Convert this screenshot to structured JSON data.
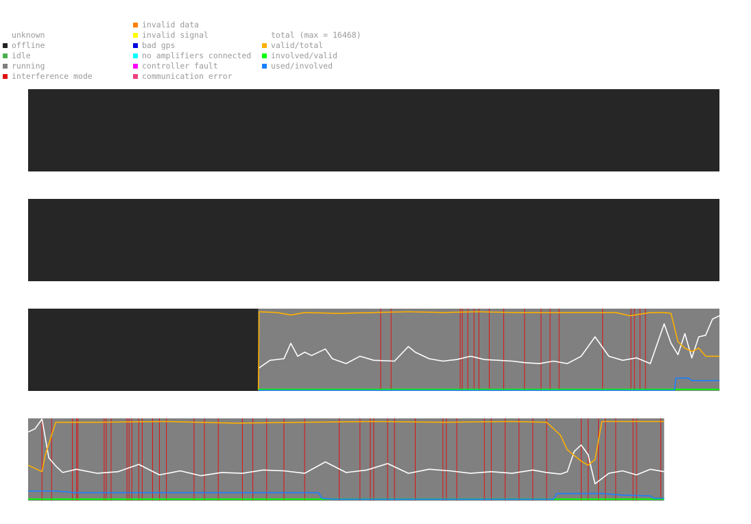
{
  "legend": {
    "columns": [
      {
        "items": [
          {
            "label": "unknown",
            "color": null
          },
          {
            "label": "offline",
            "color": "#222222"
          },
          {
            "label": "idle",
            "color": "#4caf50"
          },
          {
            "label": "running",
            "color": "#808080"
          },
          {
            "label": "interference mode",
            "color": "#e01010"
          }
        ]
      },
      {
        "items": [
          {
            "label": "invalid data",
            "color": "#ff7f00"
          },
          {
            "label": "invalid signal",
            "color": "#ffff00"
          },
          {
            "label": "bad gps",
            "color": "#0000e0"
          },
          {
            "label": "no amplifiers connected",
            "color": "#00ffff"
          },
          {
            "label": "controller fault",
            "color": "#ff00ff"
          },
          {
            "label": "communication error",
            "color": "#f04080"
          }
        ]
      },
      {
        "items": [
          {
            "label": "total (max = 16468)",
            "color": null
          },
          {
            "label": "valid/total",
            "color": "#ffb000"
          },
          {
            "label": "involved/valid",
            "color": "#00ff00"
          },
          {
            "label": "used/involved",
            "color": "#1a7fff"
          }
        ]
      }
    ]
  },
  "colors": {
    "offline_bg": "#262626",
    "running_bg": "#808080",
    "interference": "#e01010",
    "total_line": "#ffffff",
    "valid_total": "#ffb000",
    "involved_valid": "#00ff00",
    "used_involved": "#1a7fff"
  },
  "chart_data": [
    {
      "type": "line",
      "title": "",
      "status": "offline",
      "series": []
    },
    {
      "type": "line",
      "title": "",
      "status": "offline",
      "series": []
    },
    {
      "type": "line",
      "title": "",
      "status_segments": [
        {
          "status": "offline",
          "from": 0.0,
          "to": 0.333
        },
        {
          "status": "running",
          "from": 0.333,
          "to": 1.0
        }
      ],
      "interference_marks": [
        0.51,
        0.525,
        0.625,
        0.628,
        0.636,
        0.645,
        0.652,
        0.667,
        0.688,
        0.718,
        0.742,
        0.755,
        0.768,
        0.831,
        0.872,
        0.877,
        0.885,
        0.893
      ],
      "series": [
        {
          "name": "total (max = 16468)",
          "x": [
            0.333,
            0.35,
            0.37,
            0.38,
            0.39,
            0.4,
            0.41,
            0.43,
            0.44,
            0.46,
            0.48,
            0.5,
            0.53,
            0.55,
            0.56,
            0.58,
            0.6,
            0.62,
            0.64,
            0.66,
            0.68,
            0.7,
            0.72,
            0.74,
            0.76,
            0.78,
            0.8,
            0.82,
            0.84,
            0.86,
            0.88,
            0.9,
            0.92,
            0.93,
            0.94,
            0.95,
            0.96,
            0.97,
            0.98,
            0.99,
            1.0
          ],
          "y": [
            0.27,
            0.37,
            0.39,
            0.58,
            0.42,
            0.47,
            0.43,
            0.51,
            0.39,
            0.33,
            0.42,
            0.37,
            0.36,
            0.54,
            0.47,
            0.39,
            0.36,
            0.38,
            0.42,
            0.38,
            0.37,
            0.36,
            0.34,
            0.33,
            0.36,
            0.33,
            0.42,
            0.66,
            0.42,
            0.37,
            0.4,
            0.33,
            0.82,
            0.58,
            0.44,
            0.7,
            0.4,
            0.66,
            0.68,
            0.88,
            0.92
          ]
        },
        {
          "name": "valid/total",
          "x": [
            0.333,
            0.334,
            0.36,
            0.38,
            0.4,
            0.45,
            0.5,
            0.55,
            0.6,
            0.65,
            0.7,
            0.75,
            0.8,
            0.85,
            0.87,
            0.9,
            0.92,
            0.93,
            0.94,
            0.95,
            0.96,
            0.97,
            0.98,
            1.0
          ],
          "y": [
            0.0,
            0.97,
            0.96,
            0.93,
            0.96,
            0.95,
            0.96,
            0.97,
            0.96,
            0.97,
            0.96,
            0.96,
            0.96,
            0.96,
            0.92,
            0.96,
            0.96,
            0.95,
            0.6,
            0.52,
            0.48,
            0.52,
            0.42,
            0.42
          ]
        },
        {
          "name": "involved/valid",
          "x": [
            0.333,
            1.0
          ],
          "y": [
            0.01,
            0.01
          ]
        },
        {
          "name": "used/involved",
          "x": [
            0.333,
            0.935,
            0.937,
            0.955,
            0.96,
            1.0
          ],
          "y": [
            0.0,
            0.0,
            0.15,
            0.15,
            0.12,
            0.12
          ]
        }
      ]
    },
    {
      "type": "line",
      "title": "",
      "status_segments": [
        {
          "status": "running",
          "from": 0.0,
          "to": 0.92
        }
      ],
      "interference_marks": [
        0.02,
        0.034,
        0.064,
        0.07,
        0.072,
        0.11,
        0.113,
        0.12,
        0.143,
        0.146,
        0.15,
        0.16,
        0.165,
        0.18,
        0.19,
        0.2,
        0.24,
        0.255,
        0.275,
        0.31,
        0.325,
        0.345,
        0.37,
        0.4,
        0.45,
        0.48,
        0.495,
        0.5,
        0.52,
        0.53,
        0.56,
        0.6,
        0.605,
        0.62,
        0.66,
        0.67,
        0.69,
        0.71,
        0.73,
        0.75,
        0.8,
        0.81,
        0.825,
        0.835,
        0.85,
        0.875,
        0.88,
        0.915
      ],
      "series": [
        {
          "name": "total (max = 16468)",
          "x": [
            0.0,
            0.01,
            0.02,
            0.03,
            0.04,
            0.05,
            0.07,
            0.1,
            0.13,
            0.16,
            0.19,
            0.22,
            0.25,
            0.28,
            0.31,
            0.34,
            0.37,
            0.4,
            0.43,
            0.46,
            0.49,
            0.52,
            0.55,
            0.58,
            0.61,
            0.64,
            0.67,
            0.7,
            0.73,
            0.75,
            0.77,
            0.78,
            0.79,
            0.8,
            0.81,
            0.82,
            0.84,
            0.86,
            0.88,
            0.9,
            0.92
          ],
          "y": [
            0.84,
            0.88,
            1.0,
            0.52,
            0.42,
            0.34,
            0.38,
            0.33,
            0.35,
            0.44,
            0.31,
            0.36,
            0.3,
            0.34,
            0.33,
            0.37,
            0.36,
            0.33,
            0.47,
            0.34,
            0.37,
            0.45,
            0.33,
            0.38,
            0.36,
            0.33,
            0.35,
            0.33,
            0.37,
            0.34,
            0.32,
            0.35,
            0.6,
            0.68,
            0.56,
            0.2,
            0.33,
            0.36,
            0.31,
            0.38,
            0.35
          ]
        },
        {
          "name": "valid/total",
          "x": [
            0.0,
            0.02,
            0.025,
            0.04,
            0.1,
            0.2,
            0.3,
            0.4,
            0.5,
            0.6,
            0.7,
            0.75,
            0.77,
            0.78,
            0.79,
            0.8,
            0.81,
            0.82,
            0.83,
            0.9,
            0.92
          ],
          "y": [
            0.43,
            0.35,
            0.56,
            0.96,
            0.96,
            0.97,
            0.95,
            0.96,
            0.97,
            0.96,
            0.97,
            0.96,
            0.8,
            0.62,
            0.55,
            0.48,
            0.43,
            0.5,
            0.97,
            0.97,
            0.97
          ]
        },
        {
          "name": "involved/valid",
          "x": [
            0.0,
            0.92
          ],
          "y": [
            0.01,
            0.01
          ]
        },
        {
          "name": "used/involved",
          "x": [
            0.0,
            0.04,
            0.07,
            0.2,
            0.3,
            0.42,
            0.425,
            0.44,
            0.5,
            0.6,
            0.7,
            0.76,
            0.765,
            0.8,
            0.83,
            0.86,
            0.9,
            0.905,
            0.92
          ],
          "y": [
            0.11,
            0.11,
            0.09,
            0.09,
            0.09,
            0.09,
            0.02,
            0.01,
            0.01,
            0.01,
            0.01,
            0.01,
            0.08,
            0.08,
            0.08,
            0.06,
            0.05,
            0.02,
            0.02
          ]
        }
      ]
    }
  ]
}
